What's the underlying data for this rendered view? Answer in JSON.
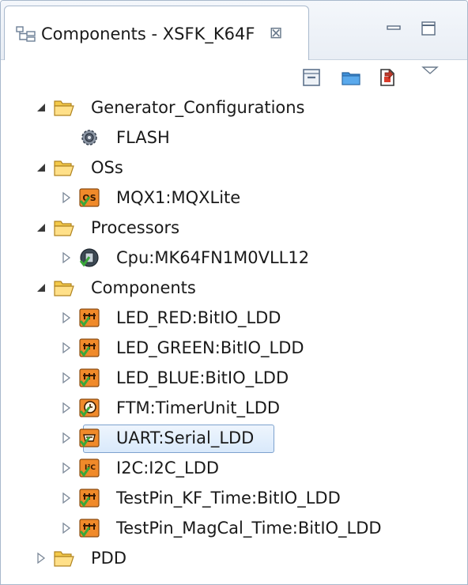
{
  "view": {
    "tab_title": "Components - XSFK_K64F",
    "close_symbol": "⊠"
  },
  "toolbar": {
    "buttons": [
      "collapse-all-icon",
      "folder-icon",
      "export-icon",
      "view-menu-icon"
    ]
  },
  "tree": [
    {
      "label": "Generator_Configurations",
      "level": 1,
      "expanded": true,
      "icon": "folder-open-icon"
    },
    {
      "label": "FLASH",
      "level": 2,
      "leaf": true,
      "icon": "gear-config-icon"
    },
    {
      "label": "OSs",
      "level": 1,
      "expanded": true,
      "icon": "folder-open-icon"
    },
    {
      "label": "MQX1:MQXLite",
      "level": 2,
      "expanded": false,
      "icon": "os-component-icon"
    },
    {
      "label": "Processors",
      "level": 1,
      "expanded": true,
      "icon": "folder-open-icon"
    },
    {
      "label": "Cpu:MK64FN1M0VLL12",
      "level": 2,
      "expanded": false,
      "icon": "cpu-chip-icon"
    },
    {
      "label": "Components",
      "level": 1,
      "expanded": true,
      "icon": "folder-open-icon"
    },
    {
      "label": "LED_RED:BitIO_LDD",
      "level": 2,
      "expanded": false,
      "icon": "bitio-component-icon"
    },
    {
      "label": "LED_GREEN:BitIO_LDD",
      "level": 2,
      "expanded": false,
      "icon": "bitio-component-icon"
    },
    {
      "label": "LED_BLUE:BitIO_LDD",
      "level": 2,
      "expanded": false,
      "icon": "bitio-component-icon"
    },
    {
      "label": "FTM:TimerUnit_LDD",
      "level": 2,
      "expanded": false,
      "icon": "timer-component-icon"
    },
    {
      "label": "UART:Serial_LDD",
      "level": 2,
      "expanded": false,
      "icon": "serial-component-icon",
      "selected": true
    },
    {
      "label": "I2C:I2C_LDD",
      "level": 2,
      "expanded": false,
      "icon": "i2c-component-icon"
    },
    {
      "label": "TestPin_KF_Time:BitIO_LDD",
      "level": 2,
      "expanded": false,
      "icon": "bitio-component-icon"
    },
    {
      "label": "TestPin_MagCal_Time:BitIO_LDD",
      "level": 2,
      "expanded": false,
      "icon": "bitio-component-icon"
    },
    {
      "label": "PDD",
      "level": 1,
      "expanded": false,
      "icon": "folder-open-icon"
    }
  ],
  "colors": {
    "component_orange": "#f08a2a",
    "check_green": "#3aa83a",
    "folder_yellow": "#f3c94a",
    "selection_border": "#7da2ce"
  }
}
